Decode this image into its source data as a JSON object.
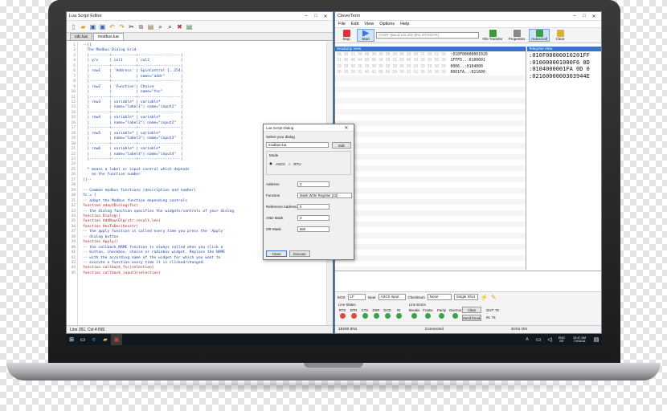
{
  "lua_editor": {
    "title": "Lua Script Editor",
    "tabs": [
      "cdc.lua",
      "modbus.lua"
    ],
    "line_numbers": [
      "1",
      "2",
      "3",
      "4",
      "5",
      "6",
      "7",
      "8",
      "9",
      "10",
      "11",
      "12",
      "13",
      "14",
      "15",
      "16",
      "17",
      "18",
      "19",
      "20",
      "21",
      "22",
      "23",
      "24",
      "25",
      "26",
      "27",
      "28",
      "29",
      "30",
      "31",
      "32",
      "33",
      "34",
      "35",
      "36",
      "37",
      "38",
      "39",
      "40",
      "41",
      "42",
      "43",
      "44",
      "45",
      "46",
      "47",
      "48",
      "49"
    ],
    "code": [
      "--[[",
      "  The Modbus Dialog Grid",
      "  |---------+-----------+-------------------|",
      "  | y/x     | col1      | col2              |",
      "  |---------+-----------+-------------------|",
      "  | row1    | 'Address' | SpinControl 1..254|",
      "  |         |           | name=\"addr\"       |",
      "  |---------+-----------+-------------------|",
      "  | row2    | 'Function'| Choice            |",
      "  |         |           | name=\"fnc\"        |",
      "  |---------+-----------+-------------------|",
      "  | row3    | variable* | variable*         |",
      "  |         | name=\"label1\"| name=\"input1\"  |",
      "  |---------+-----------+-------------------|",
      "  | row4    | variable* | variable*         |",
      "  |         | name=\"label2\"| name=\"input2\"  |",
      "  |---------+-----------+-------------------|",
      "  | row5    | variable* | variable*         |",
      "  |         | name=\"label3\"| name=\"input3\"  |",
      "  |---------+-----------+-------------------|",
      "  | row6    | variable* | variable*         |",
      "  |         | name=\"label4\"| name=\"input4\"  |",
      "  |---------+-----------+-------------------|",
      "",
      "  * means a label or input control which depends",
      "    on the function number",
      "]]--",
      "",
      "-- Common modbus functions (description and number)",
      "fc = {",
      "-- adapt the Modbus function depending controls",
      "function adaptDialog(fnc)",
      "-- the dialog function specifies the widgets/controls of your dialog",
      "function Dialog()",
      "function AddRaw(Dlg(str,result,len)",
      "function HexToDec(hexstr)",
      "-- the apply function is called every time you press the 'Apply'",
      "-- dialog button",
      "function Apply()",
      "-- the callback_NAME function is always called when you click a",
      "-- button, checkbox, choice or radiobox widget. Replace the NAME",
      "-- with the according name of the widget for which you want to",
      "-- execute a function every time it is clicked/changed.",
      "function callback_fnc(selection)",
      "function callback_input1(selection)"
    ],
    "status": "Line 351, Col 4    INS"
  },
  "cleverterm": {
    "title": "CleverTerm",
    "menu": [
      "File",
      "Edit",
      "View",
      "Options",
      "Help"
    ],
    "toolbar": {
      "stop": "Stop",
      "start": "Start",
      "port_combo": "COM7 (Baud:115,200 8N1 RTS/DTR)",
      "file_transfer": "File Transfer",
      "properties": "Properties",
      "autoscroll": "Autoscroll",
      "clear": "Clear"
    },
    "hexview_title": "Hexdump View",
    "telegram_title": "Telegram View",
    "hex_lines": [
      {
        "hex": "3A 30 31 30 46 30 30 30 30 30 30 30 31 30 32 30",
        "ascii": ":010F00000001020"
      },
      {
        "hex": "31 46 46 44 0D 0A 3A 30 31 30 46 30 30 30 30 30",
        "ascii": "1FFFD..:0100001"
      },
      {
        "hex": "30 30 30 36 30 30 30 30 30 30 30 30 30 30 30 30",
        "ascii": "0006..:0104000"
      },
      {
        "hex": "30 30 30 31 46 41 0D 0A 3A 30 32 31 36 30 30 30",
        "ascii": "0001FA..:021600"
      },
      {
        "hex": "30 30 30 30 33 30 33 39 34 34 45 0D 0A",
        "ascii": "00003039446.."
      }
    ],
    "telegrams": [
      ":010F00000010201FF",
      ":010000001000F6 0D",
      ":0104000001FA 0D 0",
      ":0216000000303944E"
    ],
    "controls": {
      "eos_label": "EOS",
      "eos_value": "LF",
      "input_label": "Input",
      "input_value": "ASCII Input",
      "checksum_label": "Checksum",
      "checksum_value": "None",
      "mode_value": "Single Shot"
    },
    "line_states": {
      "title": "Line States",
      "labels": [
        "RTS",
        "DTR",
        "CTS",
        "DSR",
        "DCD",
        "RI"
      ],
      "colors": [
        "#e24a3b",
        "#e24a3b",
        "#3aa34a",
        "#3aa34a",
        "#3aa34a",
        "#3aa34a"
      ]
    },
    "line_errors": {
      "title": "Line Errors",
      "labels": [
        "Breaks",
        "Frame",
        "Parity",
        "Overrun"
      ],
      "clear_errors": "Clear errors",
      "send_break": "Send break",
      "out": "OUT: 78",
      "in": "IN: 78"
    },
    "status": {
      "left": "19200 8N1",
      "middle": "Connected",
      "right": "Echo ON"
    }
  },
  "dialog": {
    "title": "Lua Script Dialog",
    "select_label": "Select your dialog",
    "select_value": "modbus.lua",
    "edit_button": "Edit",
    "mode_label": "Mode",
    "mode_ascii": "ASCII",
    "mode_rtu": "RTU",
    "fields": [
      {
        "label": "Address",
        "value": "2"
      },
      {
        "label": "Function",
        "value": "Mask Write Register (22)"
      },
      {
        "label": "Reference Address",
        "value": "0"
      },
      {
        "label": "AND Mask",
        "value": "3"
      },
      {
        "label": "OR Mask",
        "value": "660"
      }
    ],
    "close_button": "Close",
    "execute_button": "Execute"
  },
  "taskbar": {
    "lang": "ENG",
    "region": "DE",
    "time": "10:47 AM",
    "date": "7/4/2016"
  }
}
